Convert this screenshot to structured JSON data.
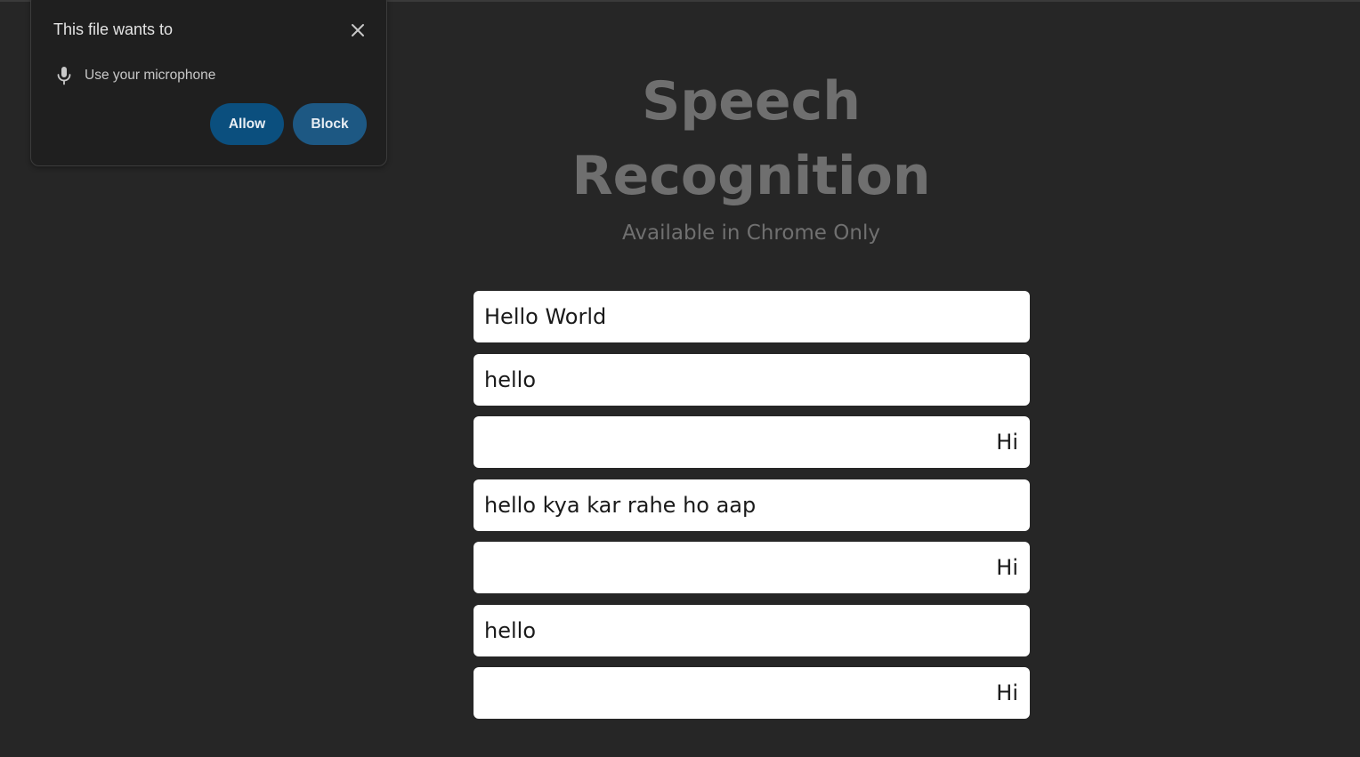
{
  "page": {
    "title_line1": "Speech",
    "title_line2": "Recognition",
    "subtitle": "Available in Chrome Only"
  },
  "messages": [
    {
      "text": "Hello World",
      "align": "left"
    },
    {
      "text": "hello",
      "align": "left"
    },
    {
      "text": "Hi",
      "align": "right"
    },
    {
      "text": "hello kya kar rahe ho aap",
      "align": "left"
    },
    {
      "text": "Hi",
      "align": "right"
    },
    {
      "text": "hello",
      "align": "left"
    },
    {
      "text": "Hi",
      "align": "right"
    }
  ],
  "permission_popup": {
    "title": "This file wants to",
    "permission_icon": "microphone-icon",
    "permission_label": "Use your microphone",
    "close_icon": "close-icon",
    "allow_label": "Allow",
    "block_label": "Block"
  },
  "colors": {
    "background": "#262626",
    "title": "#6f6f6f",
    "message_bg": "#ffffff",
    "popup_bg": "#1f1f1f",
    "allow_button": "#0b4f7e",
    "block_button": "#1d5883"
  }
}
